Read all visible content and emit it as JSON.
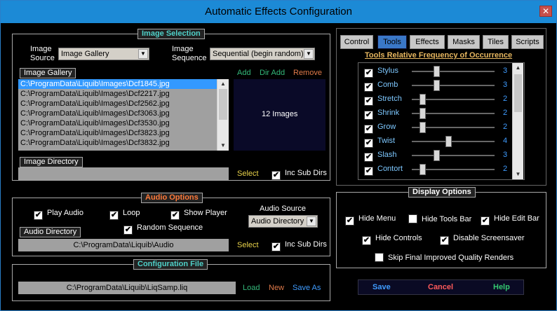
{
  "window": {
    "title": "Automatic Effects Configuration"
  },
  "colors": {
    "accent_blue": "#2f8cff",
    "label_cyan": "#4fd0c8",
    "link_green": "#34b87a",
    "link_orange": "#e07a4a",
    "audio_orange": "#ff7a3a"
  },
  "image_selection": {
    "heading": "Image Selection",
    "image_source_label": "Image\nSource",
    "image_source_value": "Image Gallery",
    "image_sequence_label": "Image\nSequence",
    "image_sequence_value": "Sequential (begin random)",
    "gallery_label": "Image Gallery",
    "add": "Add",
    "dir_add": "Dir Add",
    "remove": "Remove",
    "count": "12 Images",
    "files": [
      "C:\\ProgramData\\Liquib\\Images\\Dcf1845.jpg",
      "C:\\ProgramData\\Liquib\\Images\\Dcf2217.jpg",
      "C:\\ProgramData\\Liquib\\Images\\Dcf2562.jpg",
      "C:\\ProgramData\\Liquib\\Images\\Dcf3063.jpg",
      "C:\\ProgramData\\Liquib\\Images\\Dcf3530.jpg",
      "C:\\ProgramData\\Liquib\\Images\\Dcf3823.jpg",
      "C:\\ProgramData\\Liquib\\Images\\Dcf3832.jpg"
    ],
    "directory_label": "Image Directory",
    "directory_value": "",
    "select": "Select",
    "inc_sub_dirs": "Inc Sub Dirs"
  },
  "tabs": [
    "Control",
    "Tools",
    "Effects",
    "Masks",
    "Tiles",
    "Scripts"
  ],
  "active_tab": 1,
  "tools": {
    "heading": "Tools Relative Frequency of Occurrence",
    "items": [
      {
        "name": "Stylus",
        "value": "3",
        "level": 0.3
      },
      {
        "name": "Comb",
        "value": "3",
        "level": 0.3
      },
      {
        "name": "Stretch",
        "value": "2",
        "level": 0.13
      },
      {
        "name": "Shrink",
        "value": "2",
        "level": 0.13
      },
      {
        "name": "Grow",
        "value": "2",
        "level": 0.13
      },
      {
        "name": "Twist",
        "value": "4",
        "level": 0.44
      },
      {
        "name": "Slash",
        "value": "3",
        "level": 0.3
      },
      {
        "name": "Contort",
        "value": "2",
        "level": 0.13
      }
    ]
  },
  "audio": {
    "heading": "Audio Options",
    "play_audio": "Play Audio",
    "loop": "Loop",
    "show_player": "Show Player",
    "random_sequence": "Random Sequence",
    "source_label": "Audio Source",
    "source_value": "Audio Directory",
    "directory_label": "Audio Directory",
    "directory_value": "C:\\ProgramData\\Liquib\\Audio",
    "select": "Select",
    "inc_sub_dirs": "Inc Sub Dirs"
  },
  "display": {
    "heading": "Display Options",
    "hide_menu": "Hide Menu",
    "hide_tools_bar": "Hide Tools Bar",
    "hide_edit_bar": "Hide Edit Bar",
    "hide_controls": "Hide Controls",
    "disable_screensaver": "Disable Screensaver",
    "skip_final": "Skip Final Improved Quality Renders"
  },
  "config": {
    "heading": "Configuration File",
    "path": "C:\\ProgramData\\Liquib\\LiqSamp.liq",
    "load": "Load",
    "new": "New",
    "save_as": "Save As"
  },
  "buttons": {
    "save": "Save",
    "cancel": "Cancel",
    "help": "Help"
  }
}
